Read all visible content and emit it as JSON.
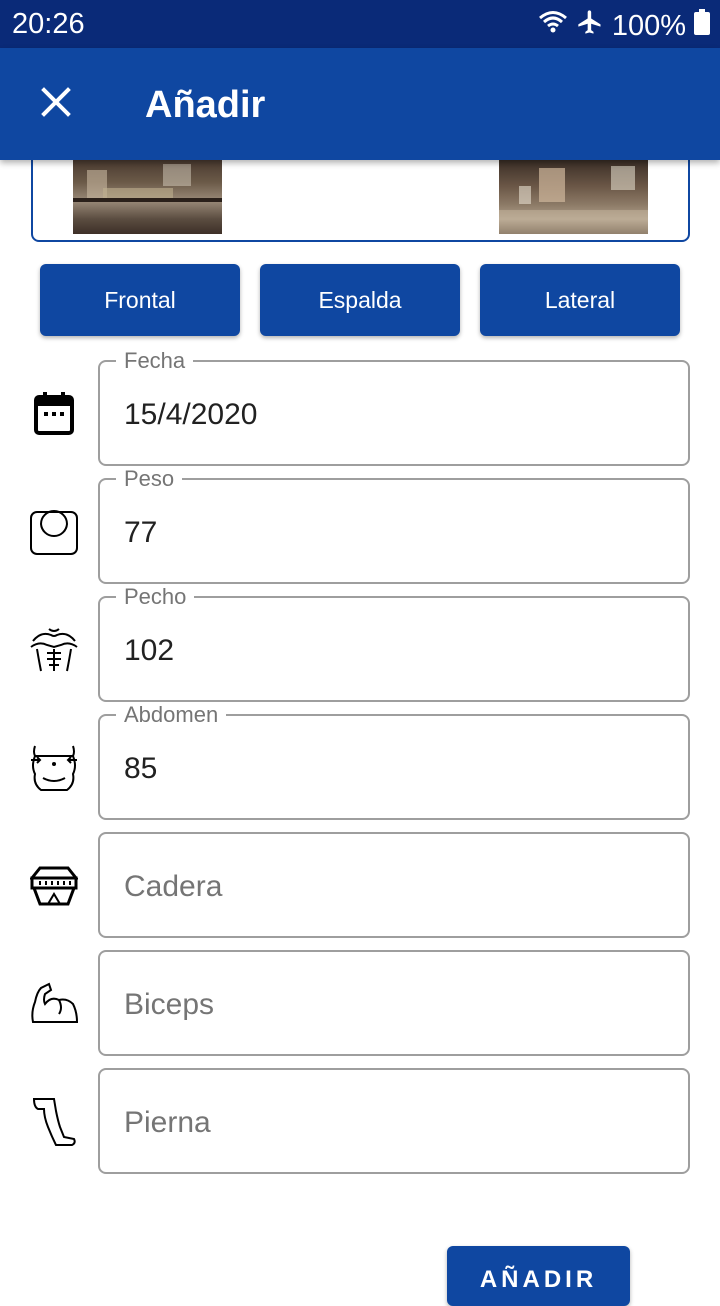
{
  "status_bar": {
    "time": "20:26",
    "battery": "100%",
    "icons": [
      "wifi-icon",
      "airplane-icon",
      "battery-icon"
    ]
  },
  "app_bar": {
    "title": "Añadir",
    "close_icon": "close-icon",
    "color": "#0f47a1"
  },
  "photos": {
    "count": 2
  },
  "tabs": [
    {
      "label": "Frontal"
    },
    {
      "label": "Espalda"
    },
    {
      "label": "Lateral"
    }
  ],
  "fields": {
    "fecha": {
      "label": "Fecha",
      "value": "15/4/2020",
      "icon": "calendar-icon"
    },
    "peso": {
      "label": "Peso",
      "value": "77",
      "icon": "scale-icon"
    },
    "pecho": {
      "label": "Pecho",
      "value": "102",
      "icon": "chest-icon"
    },
    "abdomen": {
      "label": "Abdomen",
      "value": "85",
      "icon": "abdomen-icon"
    },
    "cadera": {
      "placeholder": "Cadera",
      "icon": "hip-icon"
    },
    "biceps": {
      "placeholder": "Biceps",
      "icon": "biceps-icon"
    },
    "pierna": {
      "placeholder": "Pierna",
      "icon": "leg-icon"
    }
  },
  "submit": {
    "label": "AÑADIR"
  }
}
